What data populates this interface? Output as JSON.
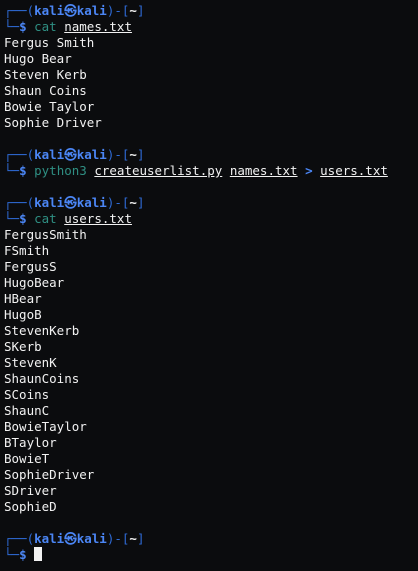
{
  "prompt": {
    "box_top_left": "┌──(",
    "user": "kali",
    "at_symbol": "㉿",
    "host": "kali",
    "box_mid": ")-[",
    "cwd": "~",
    "box_close": "]",
    "box_bottom_left": "└─",
    "dollar": "$"
  },
  "blocks": [
    {
      "command": "cat",
      "args": [
        "names.txt"
      ],
      "output": [
        "Fergus Smith",
        "Hugo Bear",
        "Steven Kerb",
        "Shaun Coins",
        "Bowie Taylor",
        "Sophie Driver"
      ]
    },
    {
      "command": "python3",
      "args": [
        "createuserlist.py",
        "names.txt"
      ],
      "redirect": ">",
      "redirect_target": "users.txt",
      "output": []
    },
    {
      "command": "cat",
      "args": [
        "users.txt"
      ],
      "output": [
        "FergusSmith",
        "FSmith",
        "FergusS",
        "HugoBear",
        "HBear",
        "HugoB",
        "StevenKerb",
        "SKerb",
        "StevenK",
        "ShaunCoins",
        "SCoins",
        "ShaunC",
        "BowieTaylor",
        "BTaylor",
        "BowieT",
        "SophieDriver",
        "SDriver",
        "SophieD"
      ]
    }
  ],
  "colors": {
    "background": "#0b0c0e",
    "prompt_blue": "#4b86f5",
    "frame_blue": "#2f6bd6",
    "command_teal": "#2f8f83",
    "text": "#f2f2f2"
  }
}
